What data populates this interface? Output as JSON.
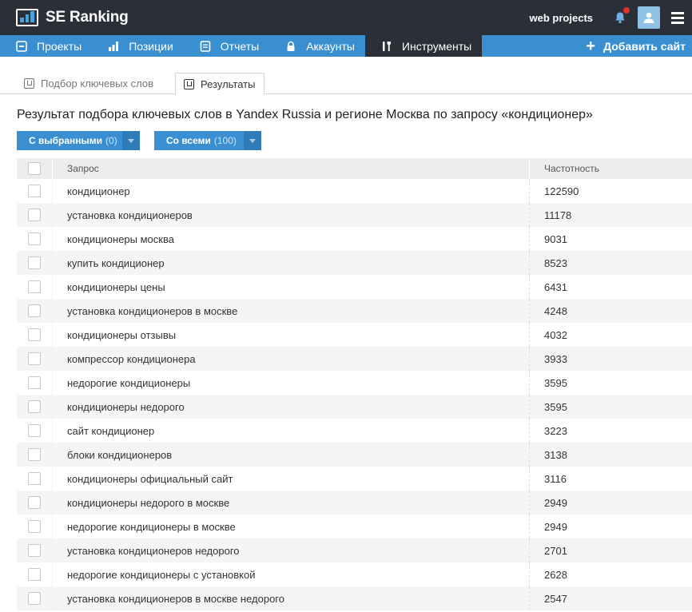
{
  "app": {
    "logo_text": "SE Ranking"
  },
  "topbar": {
    "account_label": "web projects"
  },
  "nav": {
    "items": [
      {
        "label": "Проекты",
        "icon": "projects-icon"
      },
      {
        "label": "Позиции",
        "icon": "bar-chart-icon"
      },
      {
        "label": "Отчеты",
        "icon": "report-icon"
      },
      {
        "label": "Аккаунты",
        "icon": "lock-icon"
      },
      {
        "label": "Инструменты",
        "icon": "tools-icon"
      }
    ],
    "add_site": "Добавить сайт"
  },
  "tabs": [
    {
      "label": "Подбор ключевых слов"
    },
    {
      "label": "Результаты"
    }
  ],
  "result_title": "Результат подбора ключевых слов в Yandex Russia и регионе Москва по запросу «кондиционер»",
  "buttons": {
    "selected": {
      "label": "С выбранными",
      "count": "(0)"
    },
    "all": {
      "label": "Со всеми",
      "count": "(100)"
    }
  },
  "table": {
    "columns": {
      "query": "Запрос",
      "frequency": "Частотность"
    },
    "rows": [
      {
        "query": "кондиционер",
        "frequency": "122590"
      },
      {
        "query": "установка кондиционеров",
        "frequency": "11178"
      },
      {
        "query": "кондиционеры москва",
        "frequency": "9031"
      },
      {
        "query": "купить кондиционер",
        "frequency": "8523"
      },
      {
        "query": "кондиционеры цены",
        "frequency": "6431"
      },
      {
        "query": "установка кондиционеров в москве",
        "frequency": "4248"
      },
      {
        "query": "кондиционеры отзывы",
        "frequency": "4032"
      },
      {
        "query": "компрессор кондиционера",
        "frequency": "3933"
      },
      {
        "query": "недорогие кондиционеры",
        "frequency": "3595"
      },
      {
        "query": "кондиционеры недорого",
        "frequency": "3595"
      },
      {
        "query": "сайт кондиционер",
        "frequency": "3223"
      },
      {
        "query": "блоки кондиционеров",
        "frequency": "3138"
      },
      {
        "query": "кондиционеры официальный сайт",
        "frequency": "3116"
      },
      {
        "query": "кондиционеры недорого в москве",
        "frequency": "2949"
      },
      {
        "query": "недорогие кондиционеры в москве",
        "frequency": "2949"
      },
      {
        "query": "установка кондиционеров недорого",
        "frequency": "2701"
      },
      {
        "query": "недорогие кондиционеры с установкой",
        "frequency": "2628"
      },
      {
        "query": "установка кондиционеров в москве недорого",
        "frequency": "2547"
      }
    ]
  },
  "colors": {
    "topbar": "#2b3038",
    "nav": "#3a8fd1",
    "accent": "#3a8fd1",
    "notification": "#e0302f"
  }
}
